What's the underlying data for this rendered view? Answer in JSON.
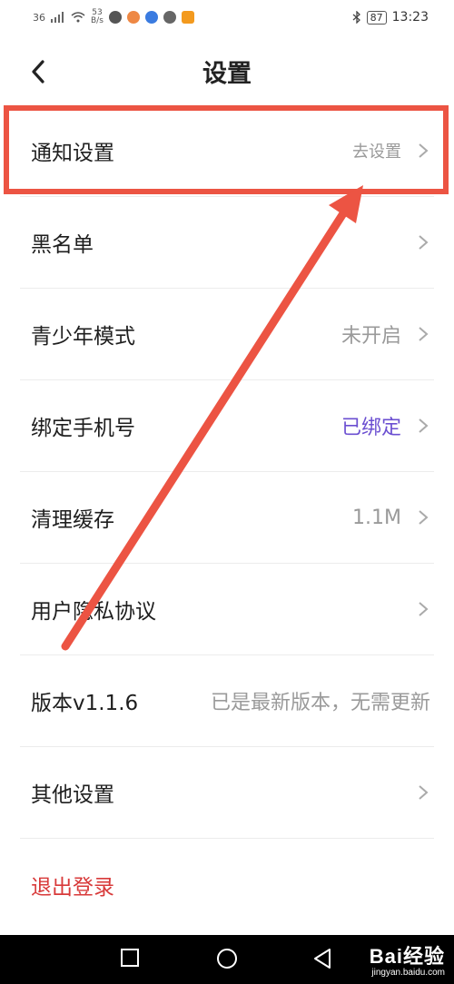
{
  "status_bar": {
    "signal": "36",
    "speed_value": "53",
    "speed_unit": "B/s",
    "battery": "87",
    "time": "13:23"
  },
  "header": {
    "title": "设置"
  },
  "settings": [
    {
      "label": "通知设置",
      "value": "去设置",
      "arrow": true
    },
    {
      "label": "黑名单",
      "value": "",
      "arrow": true
    },
    {
      "label": "青少年模式",
      "value": "未开启",
      "arrow": true
    },
    {
      "label": "绑定手机号",
      "value": "已绑定",
      "arrow": true
    },
    {
      "label": "清理缓存",
      "value": "1.1M",
      "arrow": true
    },
    {
      "label": "用户隐私协议",
      "value": "",
      "arrow": true
    },
    {
      "label": "版本v1.1.6",
      "value": "已是最新版本，无需更新",
      "arrow": false
    },
    {
      "label": "其他设置",
      "value": "",
      "arrow": true
    },
    {
      "label": "退出登录",
      "value": "",
      "arrow": false
    }
  ],
  "colors": {
    "highlight": "#ec5443",
    "accent": "#6b4fd1",
    "logout": "#d83a3a"
  },
  "watermark": {
    "main": "Bai经验",
    "sub": "jingyan.baidu.com"
  }
}
